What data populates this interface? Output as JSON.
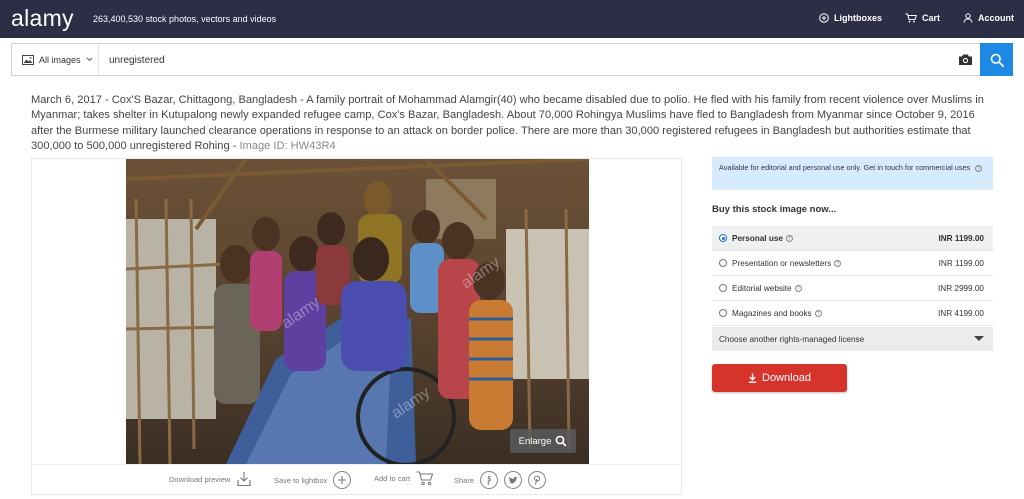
{
  "header": {
    "logo": "alamy",
    "tagline": "263,400,530 stock photos, vectors and videos",
    "nav": {
      "lightboxes": "Lightboxes",
      "cart": "Cart",
      "account": "Account"
    }
  },
  "search": {
    "type_label": "All images",
    "query": "unregistered"
  },
  "description": {
    "text": "March 6, 2017 - Cox'S Bazar, Chittagong, Bangladesh - A family portrait of Mohammad Alamgir(40) who became disabled due to polio. He fled with his family from recent violence over Muslims in Myanmar; takes shelter in Kutupalong newly expanded refugee camp, Cox's Bazar, Bangladesh. About 70,000 Rohingya Muslims have fled to Bangladesh from Myanmar since October 9, 2016 after the Burmese military launched clearance operations in response to an attack on border police. There are more than 30,000 registered refugees in Bangladesh but authorities estimate that 300,000 to 500,000 unregistered Rohing - ",
    "image_id": "Image ID: HW43R4"
  },
  "image_card": {
    "enlarge": "Enlarge",
    "download_preview": "Download preview",
    "save_to_lightbox": "Save to lightbox",
    "add_to_cart": "Add to cart",
    "share": "Share"
  },
  "purchase": {
    "notice": "Available for editorial and personal use only. Get in touch for commercial uses",
    "title": "Buy this stock image now...",
    "licenses": [
      {
        "label": "Personal use",
        "price": "INR 1199.00",
        "selected": true
      },
      {
        "label": "Presentation or newsletters",
        "price": "INR 1199.00",
        "selected": false
      },
      {
        "label": "Editorial website",
        "price": "INR 2999.00",
        "selected": false
      },
      {
        "label": "Magazines and books",
        "price": "INR 4199.00",
        "selected": false
      }
    ],
    "other_license": "Choose another rights-managed license",
    "download": "Download"
  },
  "colors": {
    "header_bg": "#2b2e44",
    "search_button": "#1e88e5",
    "download_button": "#d6342b",
    "notice_bg": "#d6ebfc"
  }
}
